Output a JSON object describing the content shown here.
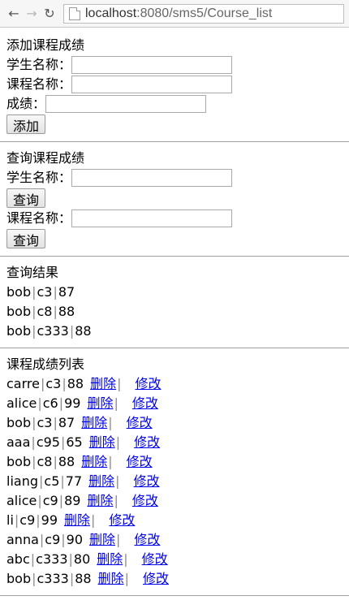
{
  "browser": {
    "url": "localhost:8080/sms5/Course_list",
    "url_host": "localhost",
    "url_rest": ":8080/sms5/Course_list"
  },
  "add_section": {
    "title": "添加课程成绩",
    "student_label": "学生名称：",
    "course_label": "课程名称：",
    "score_label": "成绩：",
    "submit_label": "添加"
  },
  "query_section": {
    "title": "查询课程成绩",
    "student_label": "学生名称：",
    "student_button": "查询",
    "course_label": "课程名称：",
    "course_button": "查询"
  },
  "results": {
    "title": "查询结果",
    "rows": [
      {
        "student": "bob",
        "course": "c3",
        "score": "87"
      },
      {
        "student": "bob",
        "course": "c8",
        "score": "88"
      },
      {
        "student": "bob",
        "course": "c333",
        "score": "88"
      }
    ]
  },
  "list": {
    "title": "课程成绩列表",
    "delete_label": "删除",
    "edit_label": "修改",
    "rows": [
      {
        "student": "carre",
        "course": "c3",
        "score": "88"
      },
      {
        "student": "alice",
        "course": "c6",
        "score": "99"
      },
      {
        "student": "bob",
        "course": "c3",
        "score": "87"
      },
      {
        "student": "aaa",
        "course": "c95",
        "score": "65"
      },
      {
        "student": "bob",
        "course": "c8",
        "score": "88"
      },
      {
        "student": "liang",
        "course": "c5",
        "score": "77"
      },
      {
        "student": "alice",
        "course": "c9",
        "score": "89"
      },
      {
        "student": "li",
        "course": "c9",
        "score": "99"
      },
      {
        "student": "anna",
        "course": "c9",
        "score": "90"
      },
      {
        "student": "abc",
        "course": "c333",
        "score": "80"
      },
      {
        "student": "bob",
        "course": "c333",
        "score": "88"
      }
    ]
  }
}
